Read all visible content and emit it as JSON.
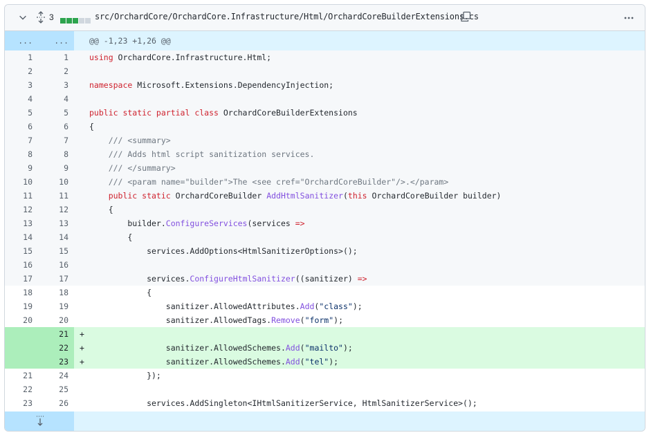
{
  "header": {
    "changes_count": "3",
    "path": "src/OrchardCore/OrchardCore.Infrastructure/Html/OrchardCoreBuilderExtensions.cs",
    "diffstat": [
      "#2da44e",
      "#2da44e",
      "#2da44e",
      "#d0d7de",
      "#d0d7de"
    ]
  },
  "hunk": {
    "left": "...",
    "right": "...",
    "text": "@@ -1,23 +1,26 @@"
  },
  "lines": [
    {
      "o": "1",
      "n": "1",
      "t": "normal",
      "code": [
        [
          "k",
          "using"
        ],
        [
          "",
          "OrchardCore.Infrastructure.Html;"
        ]
      ]
    },
    {
      "o": "2",
      "n": "2",
      "t": "normal",
      "code": []
    },
    {
      "o": "3",
      "n": "3",
      "t": "normal",
      "code": [
        [
          "k",
          "namespace"
        ],
        [
          "",
          "Microsoft.Extensions.DependencyInjection;"
        ]
      ]
    },
    {
      "o": "4",
      "n": "4",
      "t": "normal",
      "code": []
    },
    {
      "o": "5",
      "n": "5",
      "t": "normal",
      "code": [
        [
          "k",
          "public static partial class"
        ],
        [
          "",
          "OrchardCoreBuilderExtensions"
        ]
      ]
    },
    {
      "o": "6",
      "n": "6",
      "t": "normal",
      "code": [
        [
          "",
          "{"
        ]
      ]
    },
    {
      "o": "7",
      "n": "7",
      "t": "normal",
      "code": [
        [
          "c",
          "    /// <summary>"
        ]
      ]
    },
    {
      "o": "8",
      "n": "8",
      "t": "normal",
      "code": [
        [
          "c",
          "    /// Adds html script sanitization services."
        ]
      ]
    },
    {
      "o": "9",
      "n": "9",
      "t": "normal",
      "code": [
        [
          "c",
          "    /// </summary>"
        ]
      ]
    },
    {
      "o": "10",
      "n": "10",
      "t": "normal",
      "code": [
        [
          "c",
          "    /// <param name=\"builder\">The <see cref=\"OrchardCoreBuilder\"/>.</param>"
        ]
      ]
    },
    {
      "o": "11",
      "n": "11",
      "t": "normal",
      "code": [
        [
          "k",
          "    public static"
        ],
        [
          "",
          "OrchardCoreBuilder"
        ],
        [
          "f",
          "AddHtmlSanitizer"
        ],
        [
          "",
          "("
        ],
        [
          "k",
          "this"
        ],
        [
          "",
          "OrchardCoreBuilder builder)"
        ]
      ]
    },
    {
      "o": "12",
      "n": "12",
      "t": "normal",
      "code": [
        [
          "",
          "    {"
        ]
      ]
    },
    {
      "o": "13",
      "n": "13",
      "t": "normal",
      "code": [
        [
          "",
          "        builder."
        ],
        [
          "f",
          "ConfigureServices"
        ],
        [
          "",
          "(services"
        ],
        [
          "k",
          "=>"
        ]
      ]
    },
    {
      "o": "14",
      "n": "14",
      "t": "normal",
      "code": [
        [
          "",
          "        {"
        ]
      ]
    },
    {
      "o": "15",
      "n": "15",
      "t": "normal",
      "code": [
        [
          "",
          "            services.AddOptions<HtmlSanitizerOptions>();"
        ]
      ]
    },
    {
      "o": "16",
      "n": "16",
      "t": "normal",
      "code": []
    },
    {
      "o": "17",
      "n": "17",
      "t": "normal",
      "code": [
        [
          "",
          "            services."
        ],
        [
          "f",
          "ConfigureHtmlSanitizer"
        ],
        [
          "",
          "((sanitizer)"
        ],
        [
          "k",
          "=>"
        ]
      ]
    },
    {
      "o": "18",
      "n": "18",
      "t": "white",
      "code": [
        [
          "",
          "            {"
        ]
      ]
    },
    {
      "o": "19",
      "n": "19",
      "t": "white",
      "code": [
        [
          "",
          "                sanitizer.AllowedAttributes."
        ],
        [
          "f",
          "Add"
        ],
        [
          "",
          "("
        ],
        [
          "s",
          "\"class\""
        ],
        [
          "",
          ");"
        ]
      ]
    },
    {
      "o": "20",
      "n": "20",
      "t": "white",
      "code": [
        [
          "",
          "                sanitizer.AllowedTags."
        ],
        [
          "f",
          "Remove"
        ],
        [
          "",
          "("
        ],
        [
          "s",
          "\"form\""
        ],
        [
          "",
          ");"
        ]
      ]
    },
    {
      "o": "",
      "n": "21",
      "t": "add",
      "code": []
    },
    {
      "o": "",
      "n": "22",
      "t": "add",
      "code": [
        [
          "",
          "                sanitizer.AllowedSchemes."
        ],
        [
          "f",
          "Add"
        ],
        [
          "",
          "("
        ],
        [
          "s",
          "\"mailto\""
        ],
        [
          "",
          ");"
        ]
      ]
    },
    {
      "o": "",
      "n": "23",
      "t": "add",
      "code": [
        [
          "",
          "                sanitizer.AllowedSchemes."
        ],
        [
          "f",
          "Add"
        ],
        [
          "",
          "("
        ],
        [
          "s",
          "\"tel\""
        ],
        [
          "",
          ");"
        ]
      ]
    },
    {
      "o": "21",
      "n": "24",
      "t": "white",
      "code": [
        [
          "",
          "            });"
        ]
      ]
    },
    {
      "o": "22",
      "n": "25",
      "t": "white",
      "code": []
    },
    {
      "o": "23",
      "n": "26",
      "t": "white",
      "code": [
        [
          "",
          "            services.AddSingleton<IHtmlSanitizerService, HtmlSanitizerService>();"
        ]
      ]
    }
  ],
  "icons": {
    "collapse": "chevron-down-icon",
    "expand_all": "unfold-icon",
    "copy": "copy-icon",
    "more": "kebab-horizontal-icon",
    "expand_down": "fold-down-icon"
  }
}
